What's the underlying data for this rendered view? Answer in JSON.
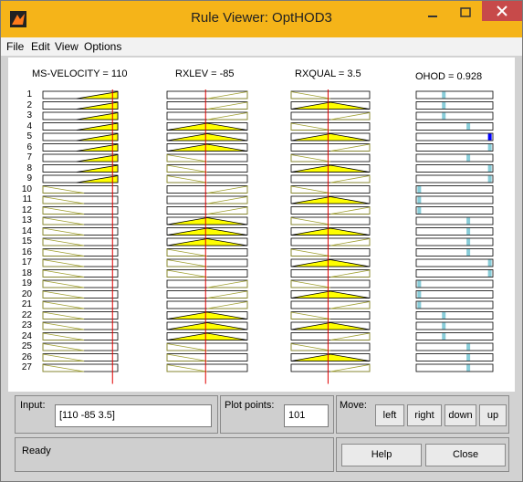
{
  "window": {
    "title": "Rule Viewer: OptHOD3"
  },
  "menu": [
    "File",
    "Edit",
    "View",
    "Options"
  ],
  "columns": [
    {
      "name": "MS-VELOCITY",
      "value": "110",
      "title": "MS-VELOCITY = 110"
    },
    {
      "name": "RXLEV",
      "value": "-85",
      "title": "RXLEV = -85"
    },
    {
      "name": "RXQUAL",
      "value": "3.5",
      "title": "RXQUAL = 3.5"
    },
    {
      "name": "OHOD",
      "value": "0.928",
      "title": "OHOD = 0.928"
    }
  ],
  "rule_numbers": [
    "1",
    "2",
    "3",
    "4",
    "5",
    "6",
    "7",
    "8",
    "9",
    "10",
    "11",
    "12",
    "13",
    "14",
    "15",
    "16",
    "17",
    "18",
    "19",
    "20",
    "21",
    "22",
    "23",
    "24",
    "25",
    "26",
    "27"
  ],
  "rules": {
    "velocity_mf": [
      "H",
      "H",
      "H",
      "H",
      "H",
      "H",
      "H",
      "H",
      "H",
      "L",
      "L",
      "L",
      "L",
      "L",
      "L",
      "L",
      "L",
      "L",
      "L",
      "L",
      "L",
      "L",
      "L",
      "L",
      "L",
      "L",
      "L"
    ],
    "rxlev_mf": [
      "H",
      "H",
      "H",
      "M",
      "M",
      "M",
      "L",
      "L",
      "L",
      "H",
      "H",
      "H",
      "M",
      "M",
      "M",
      "L",
      "L",
      "L",
      "H",
      "H",
      "H",
      "M",
      "M",
      "M",
      "L",
      "L",
      "L"
    ],
    "rxqual_mf": [
      "L",
      "M",
      "H",
      "L",
      "M",
      "H",
      "L",
      "M",
      "H",
      "L",
      "M",
      "H",
      "L",
      "M",
      "H",
      "L",
      "M",
      "H",
      "L",
      "M",
      "H",
      "L",
      "M",
      "H",
      "L",
      "M",
      "H"
    ],
    "output_level": [
      0.36,
      0.36,
      0.36,
      0.68,
      0.96,
      0.96,
      0.68,
      0.96,
      0.96,
      0.04,
      0.04,
      0.04,
      0.68,
      0.68,
      0.68,
      0.68,
      0.96,
      0.96,
      0.04,
      0.04,
      0.04,
      0.36,
      0.36,
      0.36,
      0.68,
      0.68,
      0.68
    ]
  },
  "input_markers": {
    "velocity_fraction": 0.93,
    "rxlev_fraction": 0.48,
    "rxqual_fraction": 0.47
  },
  "output_marker_fraction": 0.928,
  "controls": {
    "input_label": "Input:",
    "input_value": "[110 -85 3.5]",
    "plot_points_label": "Plot points:",
    "plot_points_value": "101",
    "move_label": "Move:",
    "left": "left",
    "right": "right",
    "down": "down",
    "up": "up",
    "status": "Ready",
    "help": "Help",
    "close": "Close"
  },
  "colors": {
    "fill": "#ffff00",
    "marker": "#e00000",
    "output_bar": "#88ccd8",
    "output_highlight": "#0000ff",
    "titlebar": "#f5b419"
  }
}
